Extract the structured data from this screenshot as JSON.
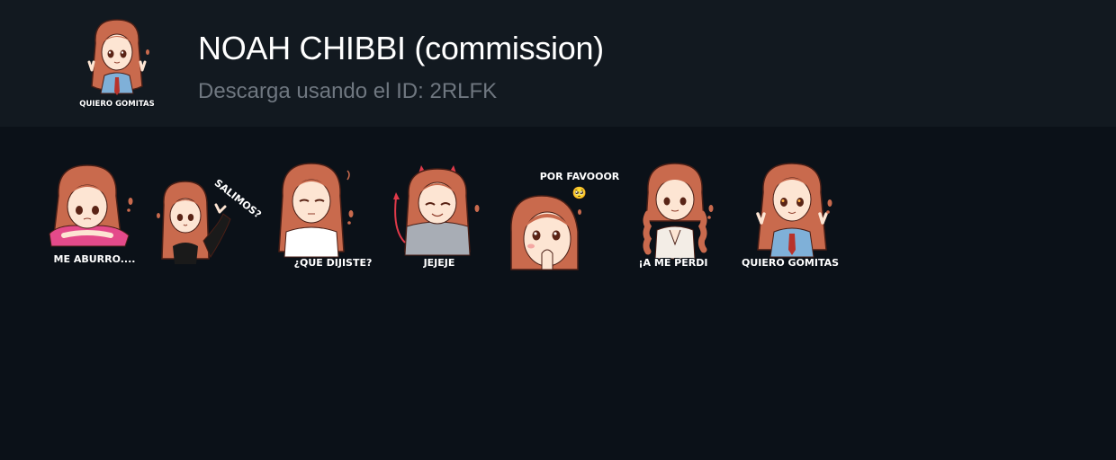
{
  "header": {
    "title": "NOAH CHIBBI (commission)",
    "download_text": "Descarga usando el ID: 2RLFK",
    "cover_caption": "QUIERO GOMITAS"
  },
  "stickers": [
    {
      "caption": "ME ABURRO....",
      "pose": "lying-bored"
    },
    {
      "caption": "SALIMOS?",
      "pose": "peace-sign-party"
    },
    {
      "caption": "¿QUE DIJISTE?",
      "pose": "arms-crossed"
    },
    {
      "caption": "JEJEJE",
      "pose": "devil-horns"
    },
    {
      "caption": "POR FAVOOOR",
      "emoji": "🥺",
      "pose": "pleading-hands"
    },
    {
      "caption": "¡A ME PERDI",
      "pose": "braids-praying"
    },
    {
      "caption": "QUIERO GOMITAS",
      "pose": "peace-sign-tie"
    }
  ],
  "colors": {
    "hair": "#c96a4d",
    "hair_shadow": "#8e3c2a",
    "skin": "#fde5d3",
    "outline": "#4a1f16",
    "header_bg": "#121920",
    "page_bg": "#0b1118",
    "title": "#ffffff",
    "subtitle": "#6f7780"
  }
}
